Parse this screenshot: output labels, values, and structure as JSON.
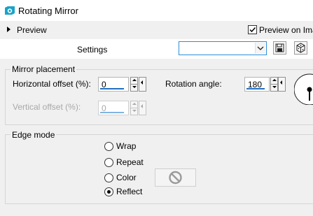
{
  "window": {
    "title": "Rotating Mirror",
    "icon": "app-icon"
  },
  "preview": {
    "toggle_label": "Preview",
    "checkbox_label": "Preview on Ima",
    "checkbox_checked": true
  },
  "settings": {
    "label": "Settings",
    "combo_value": "",
    "save_icon": "save-icon",
    "cube_icon": "cube-icon"
  },
  "mirror_placement": {
    "title": "Mirror placement",
    "horizontal_offset": {
      "label": "Horizontal offset (%):",
      "value": "0"
    },
    "rotation_angle": {
      "label": "Rotation angle:",
      "value": "180"
    },
    "vertical_offset": {
      "label": "Vertical offset (%):",
      "value": "0",
      "disabled": true
    }
  },
  "edge_mode": {
    "title": "Edge mode",
    "options": [
      {
        "label": "Wrap",
        "selected": false
      },
      {
        "label": "Repeat",
        "selected": false
      },
      {
        "label": "Color",
        "selected": false
      },
      {
        "label": "Reflect",
        "selected": true
      }
    ],
    "color_swatch_icon": "no-symbol-icon"
  },
  "colors": {
    "accent": "#1f6fc1",
    "app_icon": "#1aa3c9",
    "combo_border": "#2b8fd8"
  }
}
